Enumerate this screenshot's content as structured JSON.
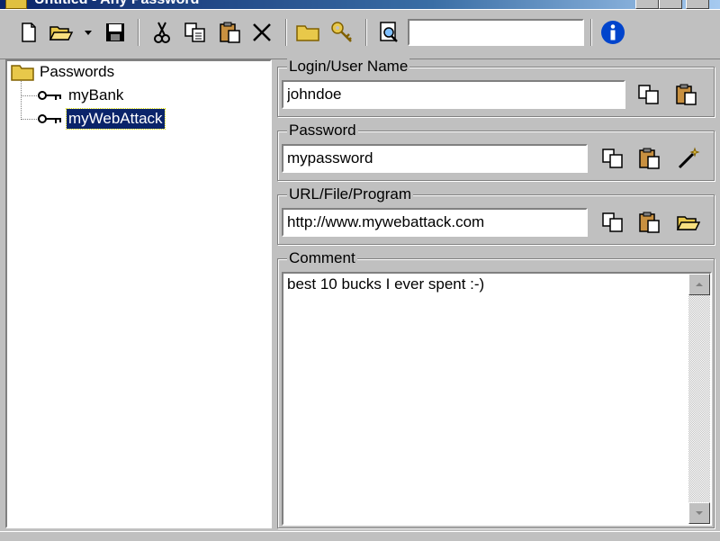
{
  "window": {
    "title": "Untitled - Any Password"
  },
  "toolbar": {
    "items": [
      "new-icon",
      "open-folder-icon",
      "dropdown-arrow-icon",
      "save-icon",
      "cut-icon",
      "copy-icon",
      "paste-icon",
      "delete-icon",
      "folder-icon",
      "key-icon",
      "find-icon",
      "info-icon"
    ],
    "search_value": ""
  },
  "tree": {
    "root_label": "Passwords",
    "items": [
      {
        "label": "myBank",
        "selected": false
      },
      {
        "label": "myWebAttack",
        "selected": true
      }
    ]
  },
  "login": {
    "legend": "Login/User Name",
    "value": "johndoe"
  },
  "password": {
    "legend": "Password",
    "value": "mypassword"
  },
  "url": {
    "legend": "URL/File/Program",
    "value": "http://www.mywebattack.com"
  },
  "comment": {
    "legend": "Comment",
    "value": "best 10 bucks I ever spent :-)"
  },
  "colors": {
    "selection": "#0a246a",
    "info_accent": "#0044cc",
    "face": "#c0c0c0"
  }
}
